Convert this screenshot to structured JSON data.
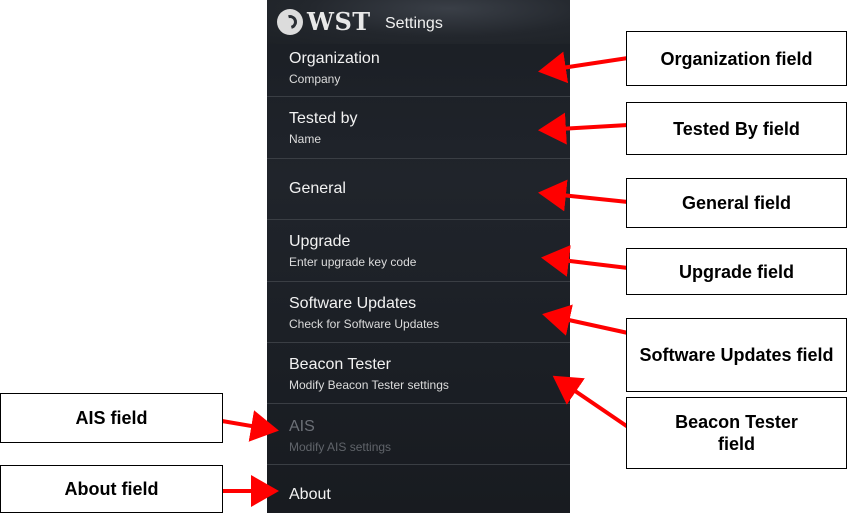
{
  "header": {
    "logo_text": "WST",
    "title": "Settings"
  },
  "settings": {
    "items": [
      {
        "title": "Organization",
        "subtitle": "Company"
      },
      {
        "title": "Tested by",
        "subtitle": "Name"
      },
      {
        "title": "General",
        "subtitle": ""
      },
      {
        "title": "Upgrade",
        "subtitle": "Enter upgrade key code"
      },
      {
        "title": "Software Updates",
        "subtitle": "Check for Software Updates"
      },
      {
        "title": "Beacon Tester",
        "subtitle": "Modify Beacon Tester settings"
      },
      {
        "title": "AIS",
        "subtitle": "Modify AIS settings",
        "disabled": true
      },
      {
        "title": "About",
        "subtitle": ""
      }
    ]
  },
  "callouts": {
    "organization": "Organization field",
    "tested_by": "Tested By field",
    "general": "General field",
    "upgrade": "Upgrade field",
    "software_updates": "Software Updates field",
    "beacon_tester": "Beacon Tester field",
    "ais": "AIS field",
    "about": "About field"
  },
  "colors": {
    "arrow": "#ff0000",
    "screen_bg": "#1e2228",
    "divider": "#3a3e44"
  }
}
